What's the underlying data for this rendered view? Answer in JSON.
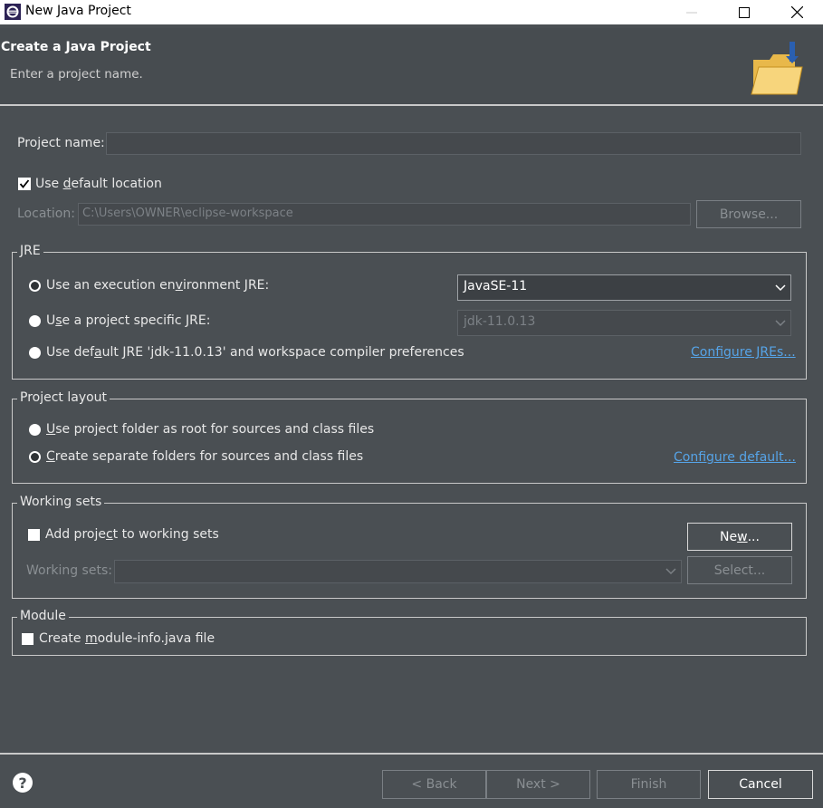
{
  "window": {
    "title": "New Java Project"
  },
  "banner": {
    "title": "Create a Java Project",
    "subtitle": "Enter a project name."
  },
  "project_name": {
    "label": "Project name:",
    "value": ""
  },
  "location": {
    "use_default_label_pre": "Use ",
    "use_default_label_acc": "d",
    "use_default_label_post": "efault location",
    "use_default_checked": true,
    "label": "Location:",
    "value": "C:\\Users\\OWNER\\eclipse-workspace",
    "browse_label": "Browse..."
  },
  "jre": {
    "legend": "JRE",
    "opt1_pre": "Use an execution en",
    "opt1_acc": "v",
    "opt1_post": "ironment JRE:",
    "opt1_value": "JavaSE-11",
    "opt2_pre": "U",
    "opt2_acc": "s",
    "opt2_post": "e a project specific JRE:",
    "opt2_value": "jdk-11.0.13",
    "opt3_pre": "Use def",
    "opt3_acc": "a",
    "opt3_post": "ult JRE 'jdk-11.0.13' and workspace compiler preferences",
    "configure_link": "Configure JREs..."
  },
  "layout": {
    "legend": "Project layout",
    "opt1_acc": "U",
    "opt1_post": "se project folder as root for sources and class files",
    "opt2_acc": "C",
    "opt2_post": "reate separate folders for sources and class files",
    "configure_link": "Configure default..."
  },
  "working_sets": {
    "legend": "Working sets",
    "add_pre": "Add proje",
    "add_acc": "c",
    "add_post": "t to working sets",
    "add_checked": false,
    "new_pre": "Ne",
    "new_acc": "w",
    "new_post": "...",
    "label": "Working sets:",
    "value": "",
    "select_label": "Select..."
  },
  "module": {
    "legend": "Module",
    "create_pre": "Create ",
    "create_acc": "m",
    "create_post": "odule-info.java file",
    "create_checked": false
  },
  "footer": {
    "help_glyph": "?",
    "back_label": "< Back",
    "next_label": "Next >",
    "finish_label": "Finish",
    "cancel_label": "Cancel"
  },
  "icons": {
    "app": "eclipse-icon",
    "banner": "folder-icon",
    "minimize": "minimize-icon",
    "maximize": "maximize-icon",
    "close": "close-icon",
    "help": "help-icon",
    "dropdown": "chevron-down-icon"
  },
  "colors": {
    "background": "#4a4f53",
    "link": "#56a4e8",
    "title_bar": "#ffffff"
  }
}
